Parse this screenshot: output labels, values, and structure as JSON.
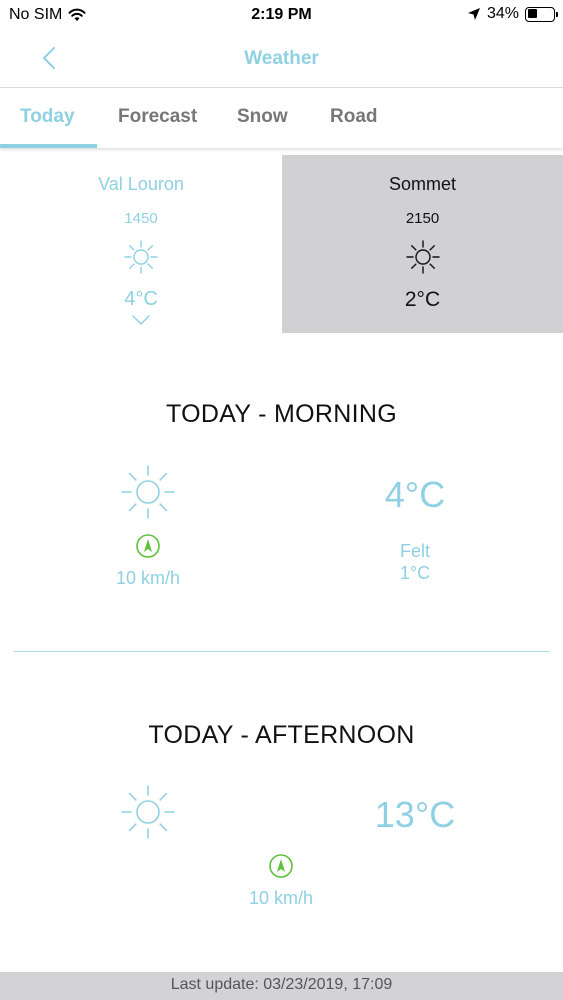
{
  "status_bar": {
    "carrier": "No SIM",
    "time": "2:19 PM",
    "battery_percent": "34%",
    "battery_level": 0.34,
    "icons": [
      "wifi-icon",
      "location-arrow-icon",
      "battery-icon"
    ]
  },
  "nav": {
    "title": "Weather",
    "back_icon": "chevron-left-icon"
  },
  "tabs": [
    {
      "label": "Today",
      "active": true
    },
    {
      "label": "Forecast",
      "active": false
    },
    {
      "label": "Snow",
      "active": false
    },
    {
      "label": "Road",
      "active": false
    }
  ],
  "stations": [
    {
      "name": "Val Louron",
      "altitude": "1450",
      "icon": "sun-icon",
      "temp": "4°C",
      "selected": false
    },
    {
      "name": "Sommet",
      "altitude": "2150",
      "icon": "sun-icon",
      "temp": "2°C",
      "selected": true
    }
  ],
  "morning": {
    "title": "TODAY - MORNING",
    "icon": "sun-icon",
    "wind_icon": "wind-direction-icon",
    "wind": "10 km/h",
    "temp": "4°C",
    "felt_label": "Felt",
    "felt_temp": "1°C"
  },
  "afternoon": {
    "title": "TODAY - AFTERNOON",
    "icon": "sun-icon",
    "wind_icon": "wind-direction-icon",
    "wind": "10 km/h",
    "temp": "13°C"
  },
  "footer": {
    "last_update": "Last update: 03/23/2019, 17:09"
  },
  "colors": {
    "accent": "#8fd0e3",
    "wind_green": "#5cc13a",
    "selected_bg": "#d1d0d3"
  }
}
